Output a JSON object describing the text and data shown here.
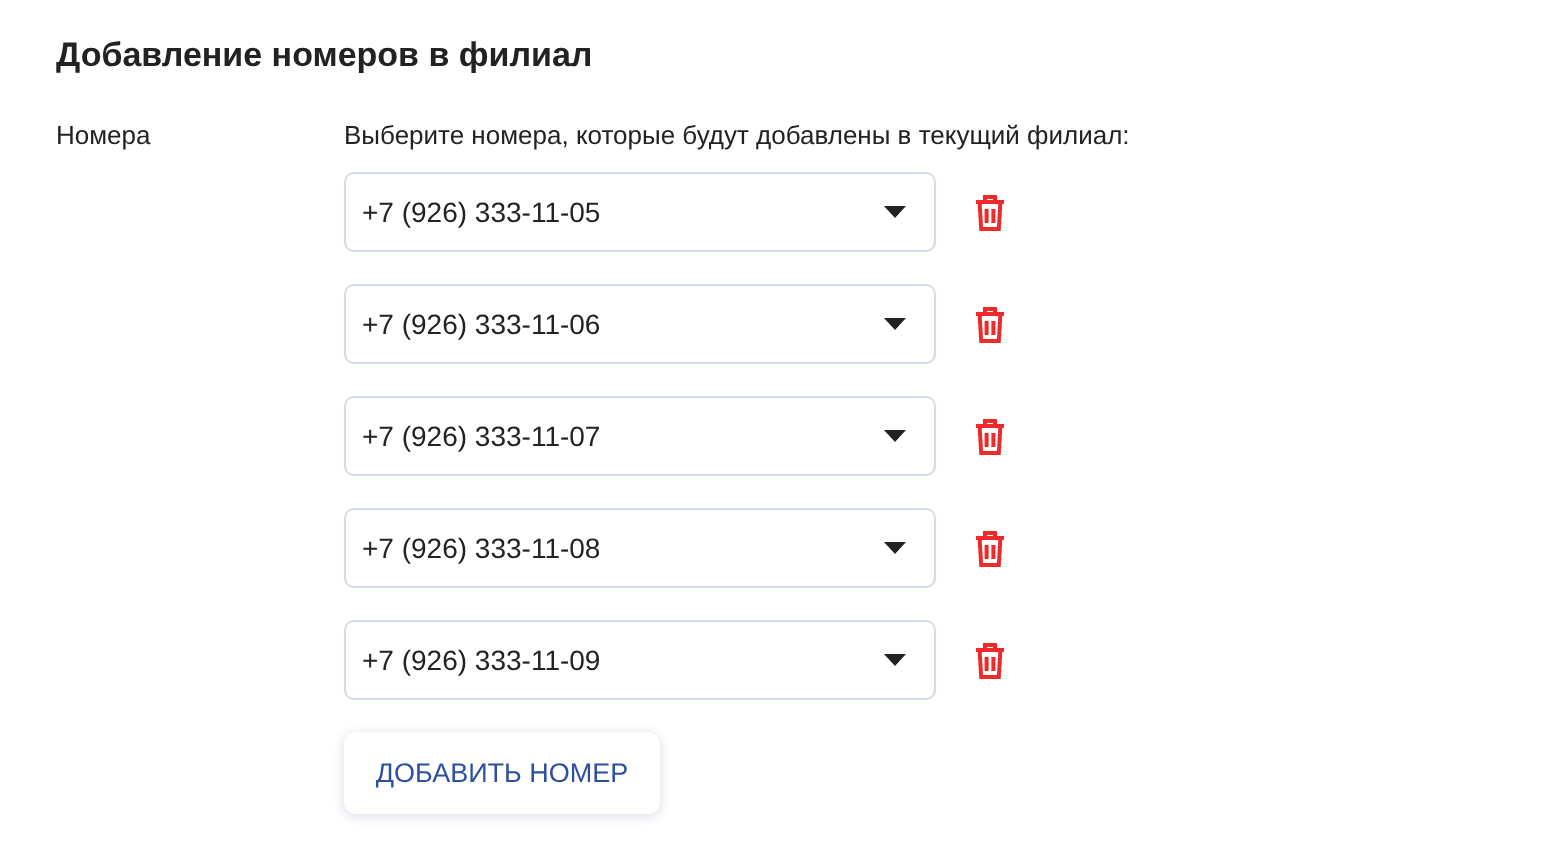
{
  "title": "Добавление номеров в филиал",
  "field_label": "Номера",
  "description": "Выберите номера, которые будут добавлены в текущий филиал:",
  "numbers": [
    {
      "value": "+7 (926) 333-11-05"
    },
    {
      "value": "+7 (926) 333-11-06"
    },
    {
      "value": "+7 (926) 333-11-07"
    },
    {
      "value": "+7 (926) 333-11-08"
    },
    {
      "value": "+7 (926) 333-11-09"
    }
  ],
  "add_button": "ДОБАВИТЬ НОМЕР"
}
